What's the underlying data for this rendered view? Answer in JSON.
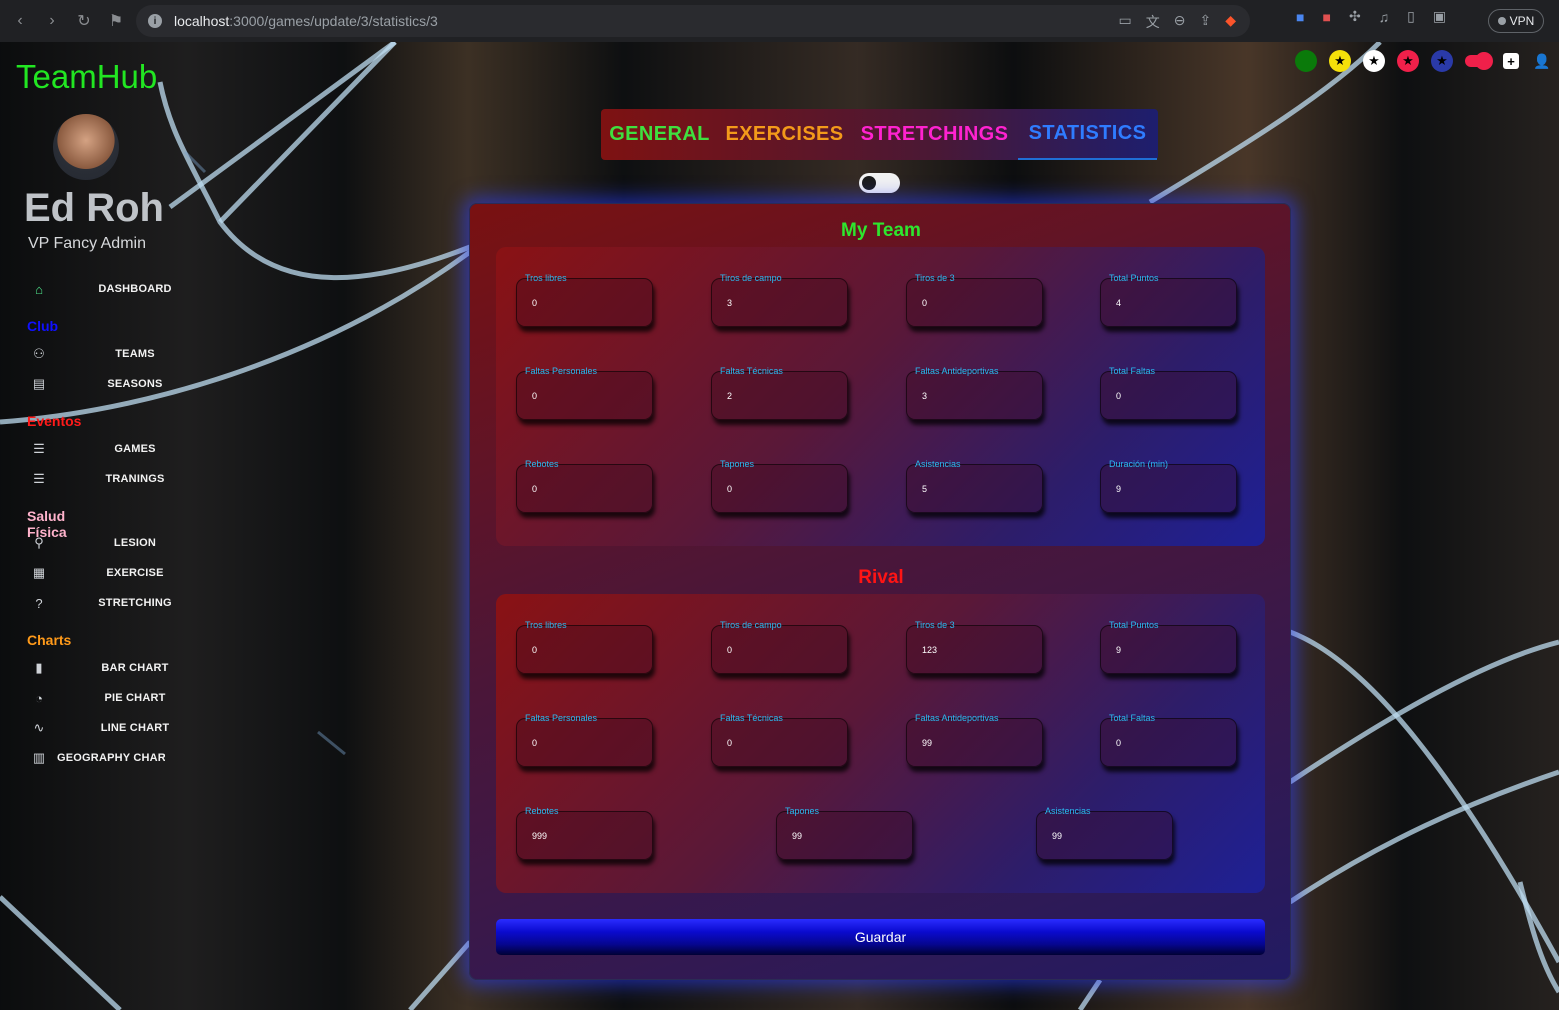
{
  "browser": {
    "url_host": "localhost",
    "url_path": ":3000/games/update/3/statistics/3",
    "vpn_label": "VPN"
  },
  "app": {
    "brand": "TeamHub"
  },
  "user": {
    "name": "Ed Roh",
    "role": "VP Fancy Admin"
  },
  "sidebar": {
    "dashboard": "DASHBOARD",
    "sections": [
      {
        "title": "Club",
        "color": "#1010ff",
        "items": [
          "TEAMS",
          "SEASONS"
        ]
      },
      {
        "title": "Eventos",
        "color": "#ff1a1a",
        "items": [
          "GAMES",
          "TRANINGS"
        ]
      },
      {
        "title": "Salud Física",
        "color": "#ffb3cc",
        "items": [
          "LESION",
          "EXERCISE",
          "STRETCHING"
        ]
      },
      {
        "title": "Charts",
        "color": "#ff9a1a",
        "items": [
          "BAR CHART",
          "PIE CHART",
          "LINE CHART",
          "GEOGRAPHY CHART"
        ]
      }
    ]
  },
  "tabs": [
    {
      "label": "GENERAL",
      "color": "#3fe03f"
    },
    {
      "label": "EXERCISES",
      "color": "#f39a1a"
    },
    {
      "label": "STRETCHINGS",
      "color": "#ff22d0"
    },
    {
      "label": "STATISTICS",
      "color": "#2f7cff"
    }
  ],
  "my_team": {
    "heading": "My Team",
    "heading_color": "#2ee62e",
    "stats": [
      {
        "label": "Tros libres",
        "value": "0"
      },
      {
        "label": "Tiros de campo",
        "value": "3"
      },
      {
        "label": "Tiros de 3",
        "value": "0"
      },
      {
        "label": "Total Puntos",
        "value": "4"
      },
      {
        "label": "Faltas Personales",
        "value": "0"
      },
      {
        "label": "Faltas Técnicas",
        "value": "2"
      },
      {
        "label": "Faltas Antideportivas",
        "value": "3"
      },
      {
        "label": "Total Faltas",
        "value": "0"
      },
      {
        "label": "Rebotes",
        "value": "0"
      },
      {
        "label": "Tapones",
        "value": "0"
      },
      {
        "label": "Asistencias",
        "value": "5"
      },
      {
        "label": "Duración (min)",
        "value": "9"
      }
    ]
  },
  "rival": {
    "heading": "Rival",
    "heading_color": "#ff1414",
    "stats": [
      {
        "label": "Tros libres",
        "value": "0"
      },
      {
        "label": "Tiros de campo",
        "value": "0"
      },
      {
        "label": "Tiros de 3",
        "value": "123"
      },
      {
        "label": "Total Puntos",
        "value": "9"
      },
      {
        "label": "Faltas Personales",
        "value": "0"
      },
      {
        "label": "Faltas Técnicas",
        "value": "0"
      },
      {
        "label": "Faltas Antideportivas",
        "value": "99"
      },
      {
        "label": "Total Faltas",
        "value": "0"
      },
      {
        "label": "Rebotes",
        "value": "999"
      },
      {
        "label": "Tapones",
        "value": "99"
      },
      {
        "label": "Asistencias",
        "value": "99"
      }
    ]
  },
  "save_label": "Guardar"
}
